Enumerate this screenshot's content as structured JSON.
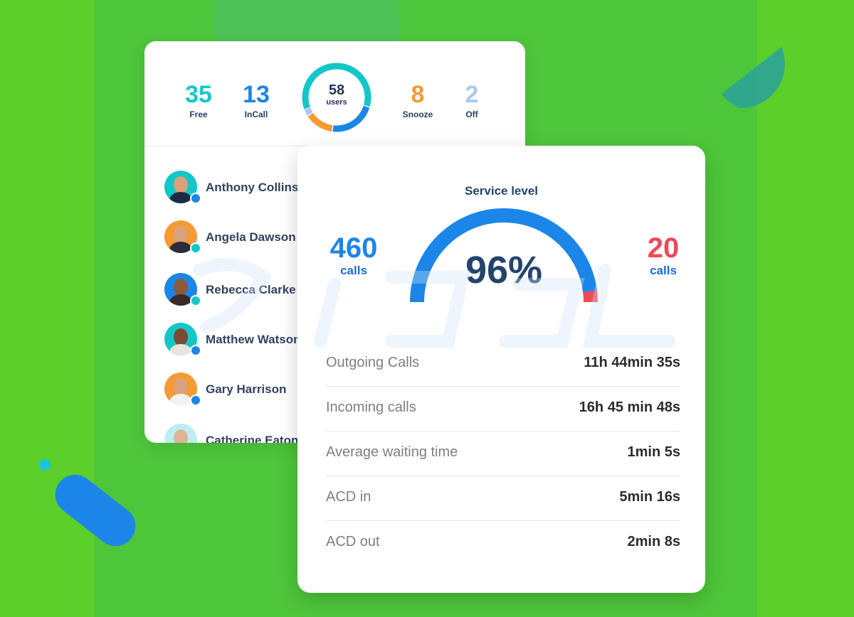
{
  "users_card": {
    "stats": [
      {
        "value": "35",
        "label": "Free",
        "color": "#14c7c7"
      },
      {
        "value": "13",
        "label": "InCall",
        "color": "#1b86e8"
      },
      {
        "value": "8",
        "label": "Snooze",
        "color": "#f59a35"
      },
      {
        "value": "2",
        "label": "Off",
        "color": "#a9c9ec"
      }
    ],
    "donut": {
      "value": "58",
      "label": "users"
    },
    "users": [
      {
        "name": "Anthony Collins",
        "status_color": "#1b86e8",
        "avatar_bg": "#14c7c7"
      },
      {
        "name": "Angela Dawson",
        "status_color": "#14c7c7",
        "avatar_bg": "#f59a35"
      },
      {
        "name": "Rebecca Clarke",
        "status_color": "#14c7c7",
        "avatar_bg": "#1b86e8"
      },
      {
        "name": "Matthew Watson",
        "status_color": "#1b86e8",
        "avatar_bg": "#14c7c7"
      },
      {
        "name": "Gary Harrison",
        "status_color": "#1b86e8",
        "avatar_bg": "#f59a35"
      },
      {
        "name": "Catherine Eaton",
        "status_color": "#14c7c7",
        "avatar_bg": "#bdeef0"
      }
    ]
  },
  "service_card": {
    "title": "Service level",
    "percent_text": "96%",
    "percent": 96,
    "left_value": "460",
    "left_label": "calls",
    "right_value": "20",
    "right_label": "calls",
    "metrics": [
      {
        "label": "Outgoing Calls",
        "value": "11h 44min 35s"
      },
      {
        "label": "Incoming calls",
        "value": "16h 45 min 48s"
      },
      {
        "label": "Average waiting time",
        "value": "1min 5s"
      },
      {
        "label": "ACD in",
        "value": "5min 16s"
      },
      {
        "label": "ACD out",
        "value": "2min 8s"
      }
    ]
  },
  "colors": {
    "background": "#5ccf2a",
    "accent_blue": "#1b86e8",
    "accent_teal": "#14c7c7",
    "accent_orange": "#f59a35",
    "accent_red": "#ee4a57"
  }
}
